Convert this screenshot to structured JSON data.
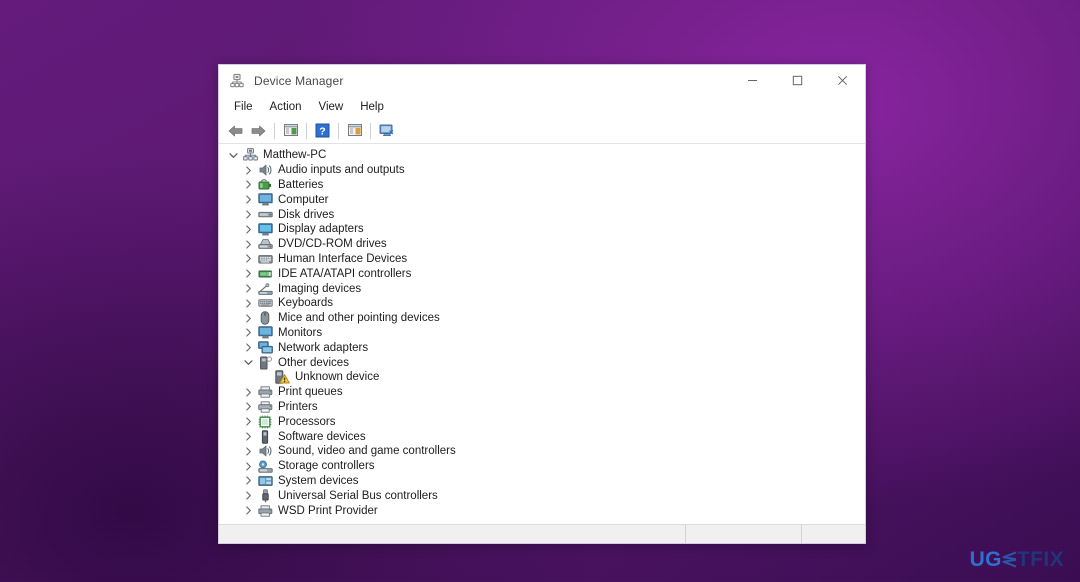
{
  "window": {
    "title": "Device Manager",
    "icon": "device-manager-icon",
    "controls": {
      "minimize_label": "—",
      "maximize_label": "□",
      "close_label": "✕"
    }
  },
  "menubar": {
    "items": [
      {
        "label": "File"
      },
      {
        "label": "Action"
      },
      {
        "label": "View"
      },
      {
        "label": "Help"
      }
    ]
  },
  "toolbar": {
    "buttons": [
      {
        "name": "back-arrow-icon",
        "tooltip": "Back"
      },
      {
        "name": "forward-arrow-icon",
        "tooltip": "Forward"
      },
      {
        "name": "show-hide-console-tree-icon",
        "tooltip": "Show/hide console tree"
      },
      {
        "name": "help-icon",
        "tooltip": "Help"
      },
      {
        "name": "properties-icon",
        "tooltip": "Properties"
      },
      {
        "name": "scan-for-hardware-changes-icon",
        "tooltip": "Scan for hardware changes"
      }
    ]
  },
  "tree": {
    "nodes": [
      {
        "label": "Matthew-PC",
        "level": 0,
        "state": "expanded",
        "icon": "computer-root-icon"
      },
      {
        "label": "Audio inputs and outputs",
        "level": 1,
        "state": "collapsed",
        "icon": "speaker-icon"
      },
      {
        "label": "Batteries",
        "level": 1,
        "state": "collapsed",
        "icon": "battery-icon"
      },
      {
        "label": "Computer",
        "level": 1,
        "state": "collapsed",
        "icon": "monitor-icon"
      },
      {
        "label": "Disk drives",
        "level": 1,
        "state": "collapsed",
        "icon": "disk-drive-icon"
      },
      {
        "label": "Display adapters",
        "level": 1,
        "state": "collapsed",
        "icon": "display-adapter-icon"
      },
      {
        "label": "DVD/CD-ROM drives",
        "level": 1,
        "state": "collapsed",
        "icon": "optical-drive-icon"
      },
      {
        "label": "Human Interface Devices",
        "level": 1,
        "state": "collapsed",
        "icon": "hid-icon"
      },
      {
        "label": "IDE ATA/ATAPI controllers",
        "level": 1,
        "state": "collapsed",
        "icon": "ide-controller-icon"
      },
      {
        "label": "Imaging devices",
        "level": 1,
        "state": "collapsed",
        "icon": "imaging-device-icon"
      },
      {
        "label": "Keyboards",
        "level": 1,
        "state": "collapsed",
        "icon": "keyboard-icon"
      },
      {
        "label": "Mice and other pointing devices",
        "level": 1,
        "state": "collapsed",
        "icon": "mouse-icon"
      },
      {
        "label": "Monitors",
        "level": 1,
        "state": "collapsed",
        "icon": "monitor-icon"
      },
      {
        "label": "Network adapters",
        "level": 1,
        "state": "collapsed",
        "icon": "network-adapter-icon"
      },
      {
        "label": "Other devices",
        "level": 1,
        "state": "expanded",
        "icon": "other-device-icon"
      },
      {
        "label": "Unknown device",
        "level": 2,
        "state": "leaf",
        "icon": "unknown-device-warning-icon"
      },
      {
        "label": "Print queues",
        "level": 1,
        "state": "collapsed",
        "icon": "printer-queue-icon"
      },
      {
        "label": "Printers",
        "level": 1,
        "state": "collapsed",
        "icon": "printer-icon"
      },
      {
        "label": "Processors",
        "level": 1,
        "state": "collapsed",
        "icon": "processor-icon"
      },
      {
        "label": "Software devices",
        "level": 1,
        "state": "collapsed",
        "icon": "software-device-icon"
      },
      {
        "label": "Sound, video and game controllers",
        "level": 1,
        "state": "collapsed",
        "icon": "speaker-icon"
      },
      {
        "label": "Storage controllers",
        "level": 1,
        "state": "collapsed",
        "icon": "storage-controller-icon"
      },
      {
        "label": "System devices",
        "level": 1,
        "state": "collapsed",
        "icon": "system-device-icon"
      },
      {
        "label": "Universal Serial Bus controllers",
        "level": 1,
        "state": "collapsed",
        "icon": "usb-icon"
      },
      {
        "label": "WSD Print Provider",
        "level": 1,
        "state": "collapsed",
        "icon": "printer-queue-icon"
      }
    ]
  },
  "statusbar": {
    "panes": [
      "",
      "",
      ""
    ]
  },
  "watermark": {
    "part_a": "UG",
    "part_e": "E",
    "part_b": "TFIX"
  },
  "colors": {
    "desktop_purple": "#5b1870",
    "desktop_purple_light": "#8a24a3",
    "desktop_purple_dark": "#3a0c52",
    "window_bg": "#ffffff",
    "statusbar_bg": "#f0f0f0",
    "watermark_blue": "#2f6fd0",
    "watermark_navy": "#20357e"
  }
}
